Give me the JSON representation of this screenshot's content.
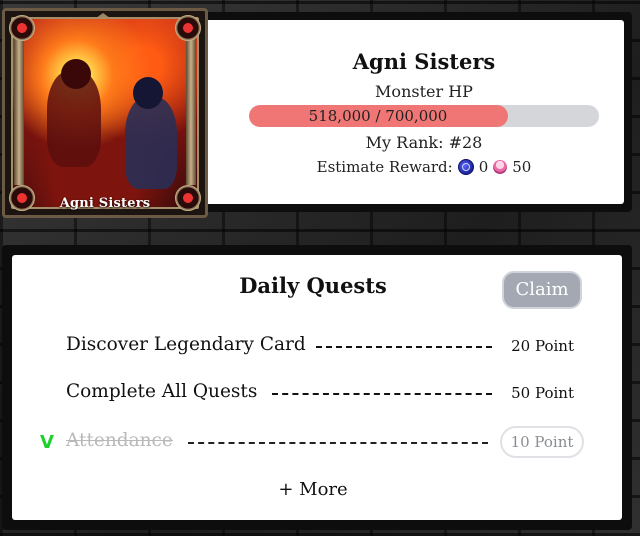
{
  "boss": {
    "name": "Agni Sisters",
    "hp_label": "Monster HP",
    "hp_text": "518,000 / 700,000",
    "hp_current": 518000,
    "hp_max": 700000,
    "rank_text": "My Rank: #28",
    "reward_label": "Estimate Reward:",
    "reward_coin_value": "0",
    "reward_gem_value": "50"
  },
  "card": {
    "name": "Agni Sisters"
  },
  "quests": {
    "title": "Daily Quests",
    "claim_label": "Claim",
    "items": [
      {
        "label": "Discover Legendary Card",
        "points": "20 Point",
        "done": false
      },
      {
        "label": "Complete All Quests",
        "points": "50 Point",
        "done": false
      },
      {
        "label": "Attendance",
        "points": "10 Point",
        "done": true,
        "check": "V"
      }
    ],
    "more_label": "+ More"
  },
  "colors": {
    "hp_fill": "#f07676",
    "hp_track": "#d4d6da",
    "check_green": "#1fd12f",
    "claim_disabled": "#a3a8b2"
  },
  "icons": [
    "coin-icon",
    "gem-icon",
    "flame-corner-icon",
    "checkmark-icon"
  ]
}
